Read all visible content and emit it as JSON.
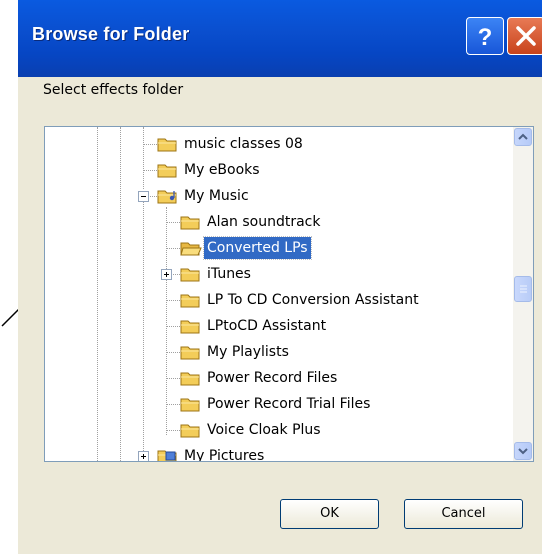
{
  "dialog": {
    "title": "Browse for Folder",
    "prompt": "Select effects folder",
    "buttons": {
      "ok": "OK",
      "cancel": "Cancel"
    }
  },
  "tree": {
    "items": [
      {
        "label": "music classes 08",
        "icon": "folder-icon",
        "expander": "none",
        "selected": false
      },
      {
        "label": "My eBooks",
        "icon": "folder-icon",
        "expander": "none",
        "selected": false
      },
      {
        "label": "My Music",
        "icon": "music-folder-icon",
        "expander": "minus",
        "selected": false
      },
      {
        "label": "Alan soundtrack",
        "icon": "folder-icon",
        "expander": "none",
        "selected": false
      },
      {
        "label": "Converted LPs",
        "icon": "open-folder-icon",
        "expander": "none",
        "selected": true
      },
      {
        "label": "iTunes",
        "icon": "folder-icon",
        "expander": "plus",
        "selected": false
      },
      {
        "label": "LP To CD Conversion Assistant",
        "icon": "folder-icon",
        "expander": "none",
        "selected": false
      },
      {
        "label": "LPtoCD Assistant",
        "icon": "folder-icon",
        "expander": "none",
        "selected": false
      },
      {
        "label": "My Playlists",
        "icon": "folder-icon",
        "expander": "none",
        "selected": false
      },
      {
        "label": "Power Record Files",
        "icon": "folder-icon",
        "expander": "none",
        "selected": false
      },
      {
        "label": "Power Record Trial Files",
        "icon": "folder-icon",
        "expander": "none",
        "selected": false
      },
      {
        "label": "Voice Cloak Plus",
        "icon": "folder-icon",
        "expander": "none",
        "selected": false
      },
      {
        "label": "My Pictures",
        "icon": "pictures-folder-icon",
        "expander": "plus",
        "selected": false
      }
    ]
  },
  "colors": {
    "titlebar": "#0a4fcf",
    "selection": "#316ac5",
    "dialog_bg": "#ece9d8"
  }
}
